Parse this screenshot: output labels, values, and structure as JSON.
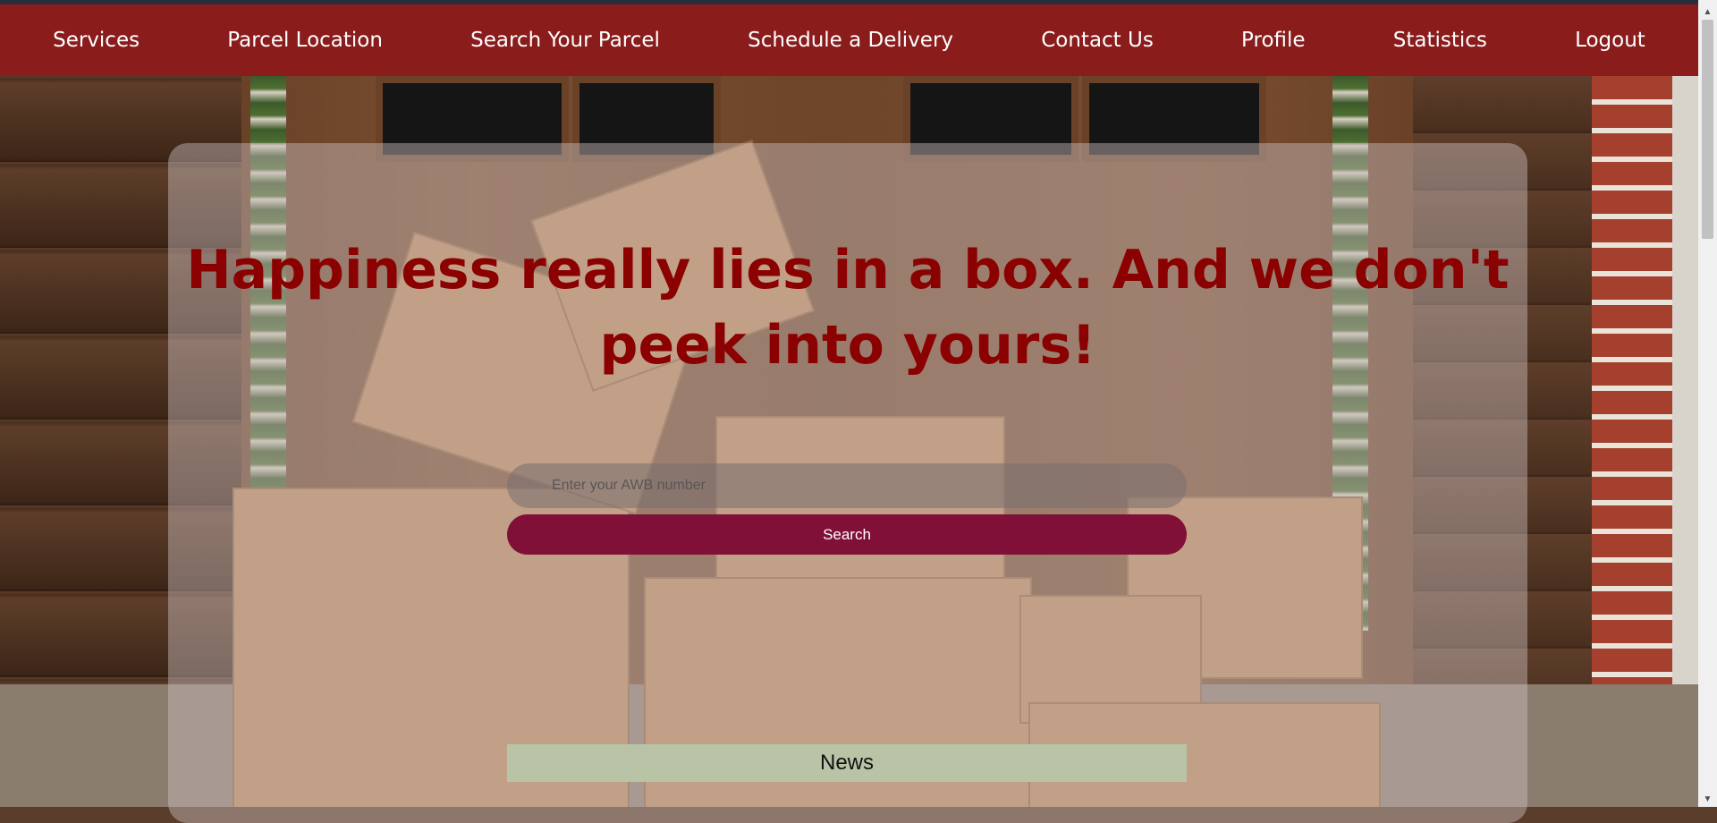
{
  "nav": {
    "items": [
      {
        "label": "Services"
      },
      {
        "label": "Parcel Location"
      },
      {
        "label": "Search Your Parcel"
      },
      {
        "label": "Schedule a Delivery"
      },
      {
        "label": "Contact Us"
      },
      {
        "label": "Profile"
      },
      {
        "label": "Statistics"
      },
      {
        "label": "Logout"
      }
    ]
  },
  "hero": {
    "headline": "Happiness really lies in a box. And we don't peek into yours!",
    "awb_placeholder": "Enter your AWB number",
    "awb_value": "",
    "search_label": "Search"
  },
  "news": {
    "title": "News"
  },
  "colors": {
    "nav_bg": "#8a1c1c",
    "headline": "#8b0000",
    "search_button": "#801038",
    "news_bg": "#b9c4a7"
  },
  "icons": {
    "scroll_up": "chevron-up-icon",
    "scroll_down": "chevron-down-icon"
  }
}
